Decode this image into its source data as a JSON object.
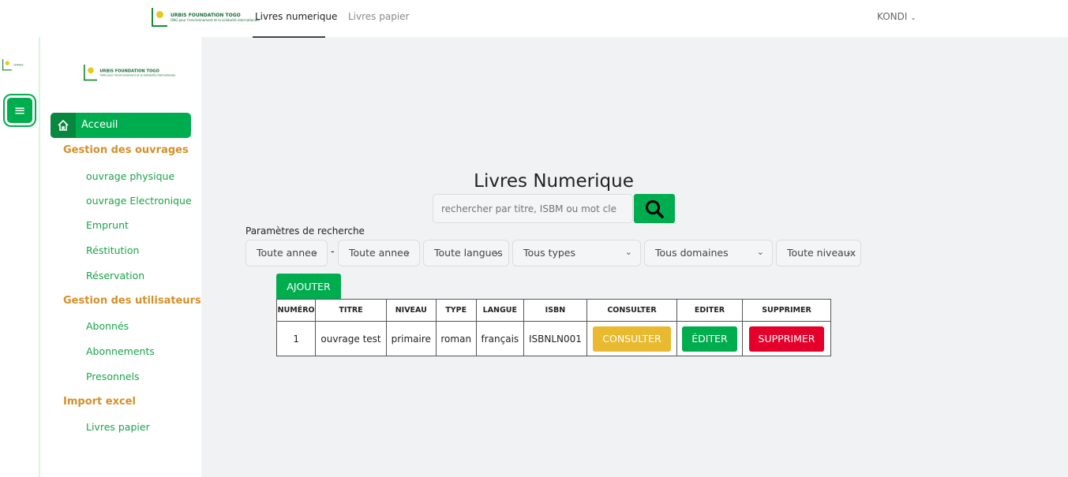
{
  "brand": {
    "name": "URBIS FOUNDATION TOGO",
    "tagline": "ONG pour l'environnement et la solidarité internationale"
  },
  "nav": {
    "tabs": [
      {
        "label": "Livres numerique",
        "active": true
      },
      {
        "label": "Livres papier",
        "active": false
      }
    ],
    "user": "KONDI"
  },
  "sidebar": {
    "home": "Acceuil",
    "sections": [
      {
        "title": "Gestion des ouvrages",
        "items": [
          "ouvrage physique",
          "ouvrage Electronique",
          "Emprunt",
          "Réstitution",
          "Réservation"
        ]
      },
      {
        "title": "Gestion des utilisateurs",
        "items": [
          "Abonnés",
          "Abonnements",
          "Presonnels"
        ]
      },
      {
        "title": "Import excel",
        "items": [
          "Livres papier"
        ]
      }
    ]
  },
  "main": {
    "title": "Livres Numerique",
    "search_placeholder": "rechercher par titre, ISBM ou mot cle",
    "params_label": "Paramètres de recherche",
    "filters": [
      "Toute annee",
      "Toute annee",
      "Toute langues",
      "Tous types",
      "Tous domaines",
      "Toute niveaux"
    ],
    "add_label": "AJOUTER",
    "columns": [
      "NUMÉRO",
      "TITRE",
      "NIVEAU",
      "TYPE",
      "LANGUE",
      "ISBN",
      "CONSULTER",
      "EDITER",
      "SUPPRIMER"
    ],
    "rows": [
      {
        "num": "1",
        "titre": "ouvrage test",
        "niveau": "primaire",
        "type": "roman",
        "langue": "français",
        "isbn": "ISBNLN001",
        "consult": "CONSULTER",
        "edit": "ÉDITER",
        "delete": "SUPPRIMER"
      }
    ]
  },
  "colors": {
    "green": "#00ad4e",
    "yellow": "#e9b92f",
    "red": "#e4002b",
    "orange": "#d4902a"
  }
}
